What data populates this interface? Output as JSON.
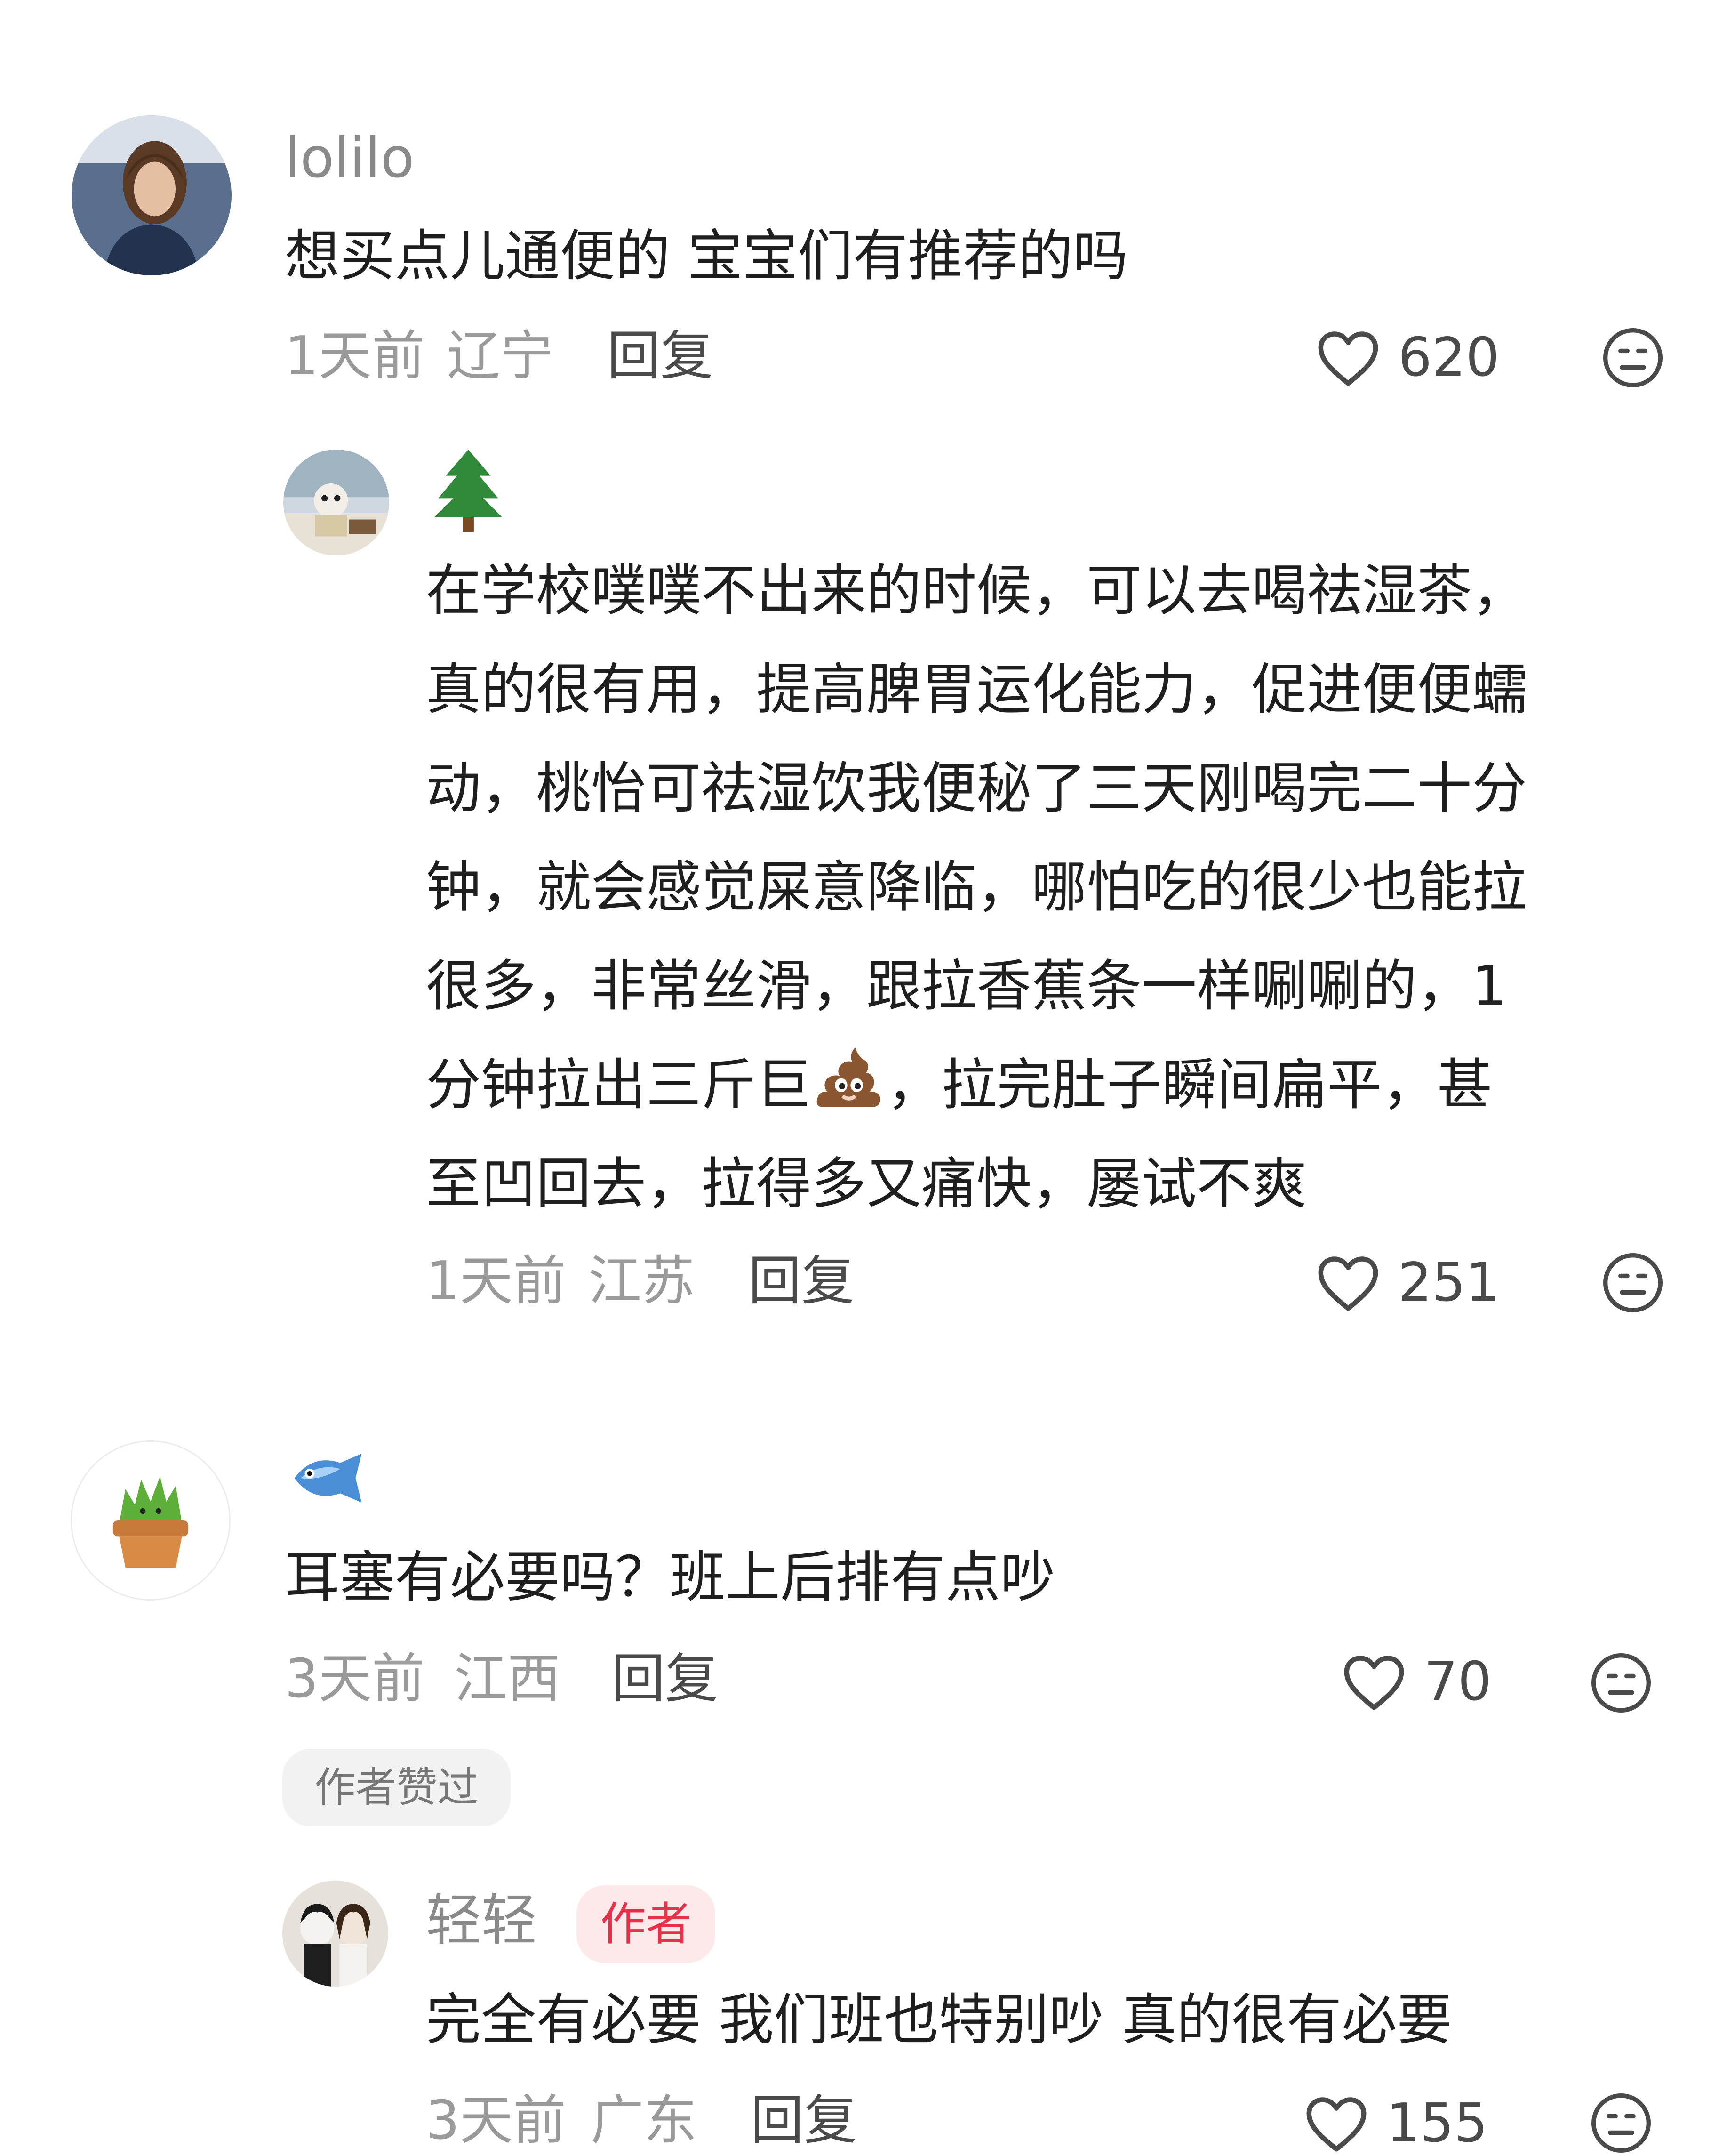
{
  "comments": [
    {
      "username": "lolilo",
      "text": "想买点儿通便的 宝宝们有推荐的吗",
      "time": "1天前",
      "location": "辽宁",
      "reply_label": "回复",
      "likes": "620",
      "replies": [
        {
          "username_icon": "tree-icon",
          "text_lines": [
            "在学校噗噗不出来的时候，可以去喝祛湿茶，",
            "真的很有用，提高脾胃运化能力，促进便便蠕",
            "动，桃怡可祛湿饮我便秘了三天刚喝完二十分",
            "钟，就会感觉屎意降临，哪怕吃的很少也能拉",
            "很多，非常丝滑，跟拉香蕉条一样唰唰的，1",
            "分钟拉出三斤巨",
            "，拉完肚子瞬间扁平，甚",
            "至凹回去，拉得多又痛快，屡试不爽"
          ],
          "time": "1天前",
          "location": "江苏",
          "reply_label": "回复",
          "likes": "251"
        }
      ]
    },
    {
      "username_icon": "fish-icon",
      "text": "耳塞有必要吗？班上后排有点吵",
      "time": "3天前",
      "location": "江西",
      "reply_label": "回复",
      "likes": "70",
      "author_liked_badge": "作者赞过",
      "replies": [
        {
          "username": "轻轻",
          "author_badge": "作者",
          "text": "完全有必要 我们班也特别吵 真的很有必要",
          "time": "3天前",
          "location": "广东",
          "reply_label": "回复",
          "likes": "155"
        }
      ]
    }
  ],
  "colors": {
    "meta_gray": "#9a9a9a",
    "text": "#1f1f1f",
    "author_badge_bg": "#fde8ea",
    "author_badge_text": "#e8304a",
    "liked_badge_bg": "#f2f2f2"
  }
}
